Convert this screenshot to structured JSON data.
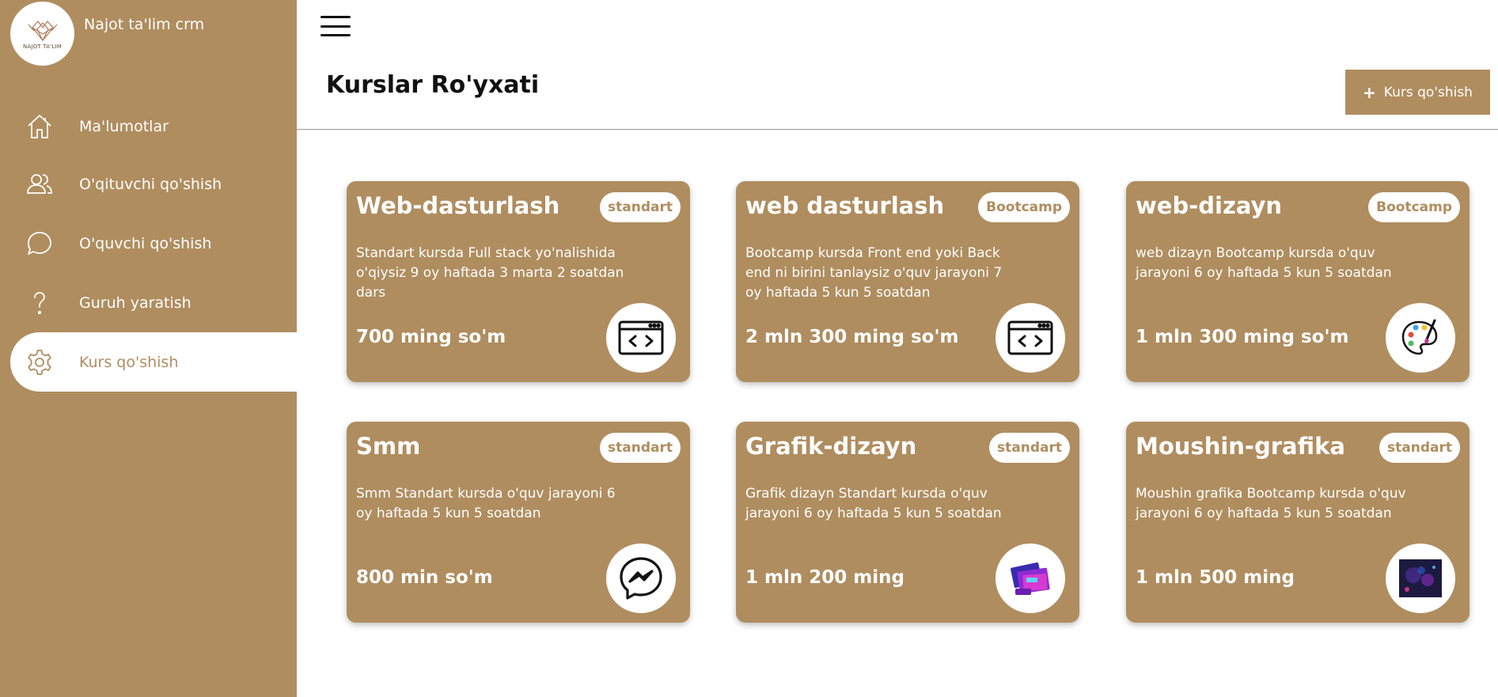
{
  "app": {
    "name": "Najot ta'lim crm",
    "logo_text": "NAJOT TA'LIM"
  },
  "sidebar": {
    "items": [
      {
        "label": "Ma'lumotlar",
        "icon": "home-icon"
      },
      {
        "label": "O'qituvchi qo'shish",
        "icon": "users-icon"
      },
      {
        "label": "O'quvchi qo'shish",
        "icon": "chat-bubble-icon"
      },
      {
        "label": "Guruh yaratish",
        "icon": "question-icon"
      },
      {
        "label": "Kurs qo'shish",
        "icon": "gear-icon",
        "active": true
      }
    ]
  },
  "header": {
    "title": "Kurslar Ro'yxati",
    "add_button_label": "Kurs qo'shish",
    "add_button_icon": "plus-icon"
  },
  "courses": [
    {
      "title": "Web-dasturlash",
      "badge": "standart",
      "description": "Standart kursda Full stack yo'nalishida o'qiysiz 9 oy haftada 3 marta 2 soatdan dars",
      "price": "700 ming so'm",
      "icon": "code-window-icon"
    },
    {
      "title": "web dasturlash",
      "badge": "Bootcamp",
      "description": "Bootcamp kursda Front end yoki Back end ni birini tanlaysiz o'quv jarayoni 7 oy haftada 5 kun 5 soatdan",
      "price": "2 mln 300 ming so'm",
      "icon": "code-window-icon"
    },
    {
      "title": "web-dizayn",
      "badge": "Bootcamp",
      "description": "web dizayn Bootcamp kursda o'quv jarayoni 6 oy haftada 5 kun 5 soatdan",
      "price": "1 mln 300 ming so'm",
      "icon": "paint-palette-icon"
    },
    {
      "title": "Smm",
      "badge": "standart",
      "description": "Smm Standart kursda o'quv jarayoni 6 oy haftada 5 kun 5 soatdan",
      "price": "800 min so'm",
      "icon": "messenger-icon"
    },
    {
      "title": "Grafik-dizayn",
      "badge": "standart",
      "description": "Grafik dizayn Standart kursda o'quv jarayoni 6 oy haftada 5 kun 5 soatdan",
      "price": "1 mln 200 ming",
      "icon": "graphic-design-image-icon"
    },
    {
      "title": "Moushin-grafika",
      "badge": "standart",
      "description": "Moushin grafika Bootcamp kursda o'quv jarayoni 6 oy haftada 5 kun 5 soatdan",
      "price": "1 mln 500 ming",
      "icon": "motion-graphics-image-icon"
    }
  ],
  "colors": {
    "brand": "#af8d5f",
    "background": "#ffffff",
    "text_dark": "#111111"
  }
}
